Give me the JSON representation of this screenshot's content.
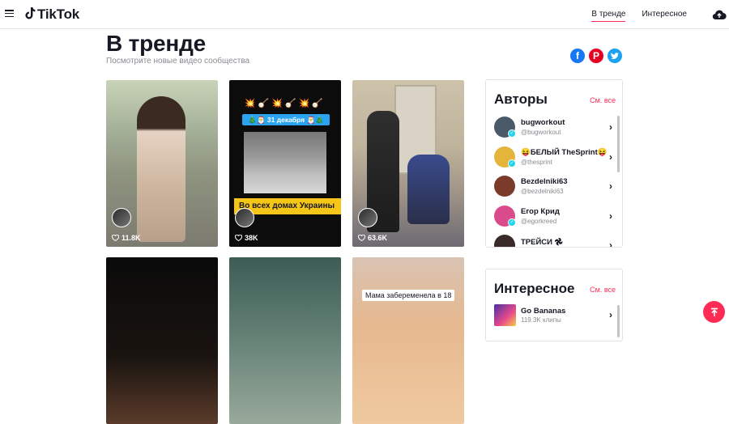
{
  "header": {
    "logo_text": "TikTok",
    "nav": [
      {
        "label": "В тренде",
        "active": true
      },
      {
        "label": "Интересное",
        "active": false
      }
    ]
  },
  "page": {
    "title": "В тренде",
    "subtitle": "Посмотрите новые видео сообщества"
  },
  "share": [
    "facebook-icon",
    "pinterest-icon",
    "twitter-icon"
  ],
  "videos": [
    {
      "likes": "11.8K"
    },
    {
      "likes": "38K",
      "top_emojis": "💥🪕💥🪕💥🪕",
      "date_banner": "🎄🎅 31 декабря 🎅🎄",
      "overlay_text": "Во всех домах Украины"
    },
    {
      "likes": "63.6K"
    },
    {
      "likes": ""
    },
    {
      "likes": ""
    },
    {
      "likes": "",
      "caption": "Мама забеременела в 18"
    }
  ],
  "authors_panel": {
    "title": "Авторы",
    "see_all": "См. все",
    "items": [
      {
        "name": "bugworkout",
        "handle": "@bugworkout",
        "verified": true,
        "avatar_color": "#4a5a6a"
      },
      {
        "name": "😝БЕЛЫЙ TheSprint😝",
        "handle": "@thesprint",
        "verified": true,
        "avatar_color": "#e5b53b"
      },
      {
        "name": "Bezdelniki63",
        "handle": "@bezdelniki63",
        "verified": false,
        "avatar_color": "#7a3b2a"
      },
      {
        "name": "Егор Крид",
        "handle": "@egorkreed",
        "verified": true,
        "avatar_color": "#d94b8a"
      },
      {
        "name": "ТРЕЙСИ 𖣘",
        "handle": "",
        "verified": false,
        "avatar_color": "#3a2a2a"
      }
    ]
  },
  "interesting_panel": {
    "title": "Интересное",
    "see_all": "См. все",
    "items": [
      {
        "name": "Go Bananas",
        "count": "119.3K клипы"
      }
    ]
  },
  "colors": {
    "accent": "#fe2c55",
    "facebook": "#1877f2",
    "pinterest": "#e60023",
    "twitter": "#1da1f2"
  }
}
